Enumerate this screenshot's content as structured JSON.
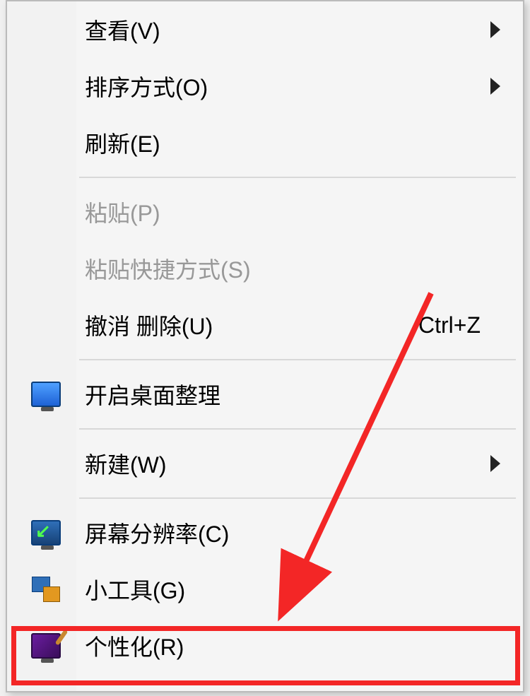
{
  "menu": {
    "items": [
      {
        "label": "查看(V)",
        "has_submenu": true,
        "enabled": true,
        "icon": null,
        "shortcut": null
      },
      {
        "label": "排序方式(O)",
        "has_submenu": true,
        "enabled": true,
        "icon": null,
        "shortcut": null
      },
      {
        "label": "刷新(E)",
        "has_submenu": false,
        "enabled": true,
        "icon": null,
        "shortcut": null
      },
      {
        "separator": true
      },
      {
        "label": "粘贴(P)",
        "has_submenu": false,
        "enabled": false,
        "icon": null,
        "shortcut": null
      },
      {
        "label": "粘贴快捷方式(S)",
        "has_submenu": false,
        "enabled": false,
        "icon": null,
        "shortcut": null
      },
      {
        "label": "撤消 删除(U)",
        "has_submenu": false,
        "enabled": true,
        "icon": null,
        "shortcut": "Ctrl+Z"
      },
      {
        "separator": true
      },
      {
        "label": "开启桌面整理",
        "has_submenu": false,
        "enabled": true,
        "icon": "desktop-organize-icon",
        "shortcut": null
      },
      {
        "separator": true
      },
      {
        "label": "新建(W)",
        "has_submenu": true,
        "enabled": true,
        "icon": null,
        "shortcut": null
      },
      {
        "separator": true
      },
      {
        "label": "屏幕分辨率(C)",
        "has_submenu": false,
        "enabled": true,
        "icon": "screen-resolution-icon",
        "shortcut": null
      },
      {
        "label": "小工具(G)",
        "has_submenu": false,
        "enabled": true,
        "icon": "gadget-icon",
        "shortcut": null
      },
      {
        "label": "个性化(R)",
        "has_submenu": false,
        "enabled": true,
        "icon": "personalize-icon",
        "shortcut": null,
        "highlighted": true
      }
    ]
  },
  "annotation": {
    "highlight_target": "个性化(R)",
    "highlight_color": "#f32626"
  }
}
